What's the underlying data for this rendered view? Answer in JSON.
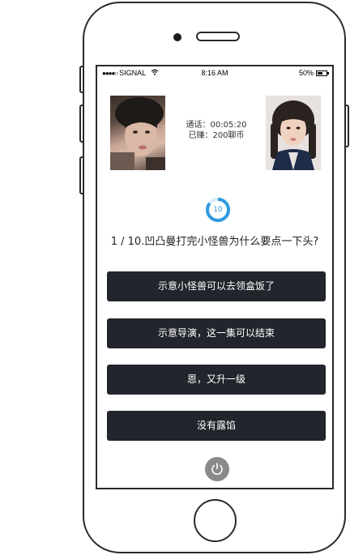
{
  "status_bar": {
    "carrier": "SIGNAL",
    "time": "8:16 AM",
    "battery": "50%"
  },
  "call": {
    "duration_label": "通话：00:05:20",
    "earned_label": "已赚：200聊币"
  },
  "timer": {
    "value": "10",
    "progress": 0.85,
    "color": "#2f9be0"
  },
  "question": {
    "text": "1 / 10.凹凸曼打完小怪兽为什么要点一下头?"
  },
  "answers": [
    {
      "label": "示意小怪兽可以去领盒饭了"
    },
    {
      "label": "示意导演，这一集可以结束"
    },
    {
      "label": "恩，又升一级"
    },
    {
      "label": "没有露馅"
    }
  ],
  "colors": {
    "answer_bg": "#22252c",
    "hangup_bg": "#8a8a8a"
  },
  "icons": {
    "wifi": "wifi-icon",
    "battery": "battery-icon",
    "hangup": "power-icon"
  }
}
